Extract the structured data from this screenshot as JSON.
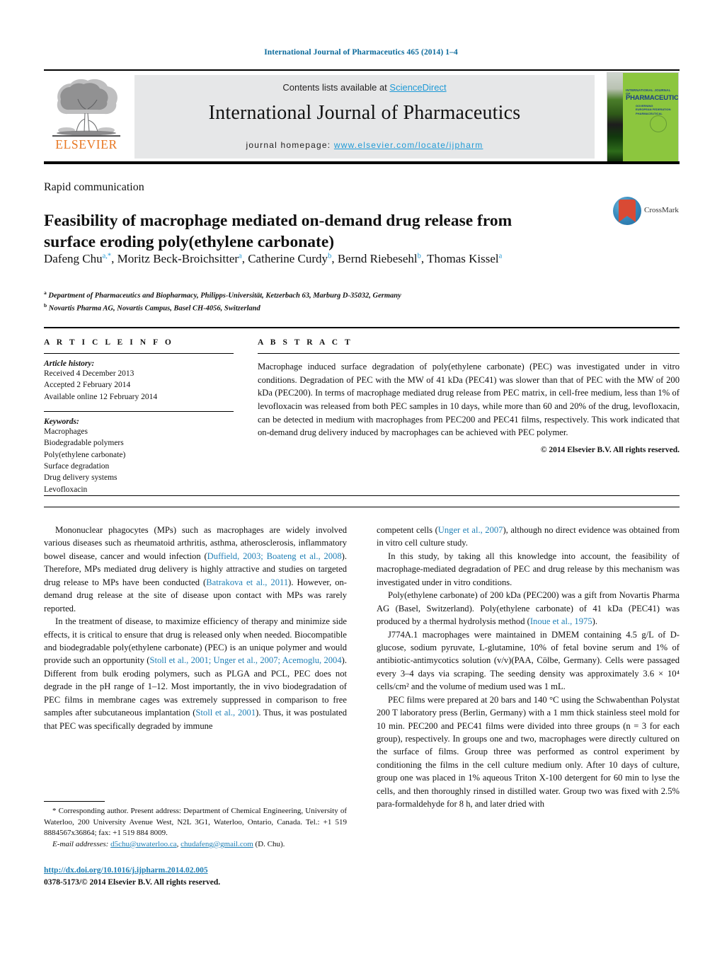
{
  "running_head": "International Journal of Pharmaceutics 465 (2014) 1–4",
  "masthead": {
    "contents_prefix": "Contents lists available at ",
    "sciencedirect": "ScienceDirect",
    "journal_title": "International Journal of Pharmaceutics",
    "homepage_label": "journal homepage: ",
    "homepage_url": "www.elsevier.com/locate/ijpharm",
    "publisher_logo_text": "ELSEVIER",
    "publisher_logo_color": "#e87722",
    "cover": {
      "line1": "INTERNATIONAL JOURNAL OF",
      "line2": "PHARMACEUTICS",
      "line3": "GOVERNING\\nEUROPEAN FEDERATION\\nPHARMACEUTICAL",
      "background_color": "#8cc63e"
    }
  },
  "article": {
    "type": "Rapid communication",
    "title": "Feasibility of macrophage mediated on-demand drug release from surface eroding poly(ethylene carbonate)",
    "authors_html": "Dafeng Chu<sup>a,*</sup>, Moritz Beck-Broichsitter<sup>a</sup>, Catherine Curdy<sup>b</sup>, Bernd Riebesehl<sup>b</sup>, Thomas Kissel<sup>a</sup>",
    "affiliation_a": "Department of Pharmaceutics and Biopharmacy, Philipps-Universität, Ketzerbach 63, Marburg D-35032, Germany",
    "affiliation_b": "Novartis Pharma AG, Novartis Campus, Basel CH-4056, Switzerland",
    "crossmark_label": "CrossMark"
  },
  "article_info": {
    "heading": "A R T I C L E   I N F O",
    "history_label": "Article history:",
    "history": [
      "Received 4 December 2013",
      "Accepted 2 February 2014",
      "Available online 12 February 2014"
    ],
    "keywords_label": "Keywords:",
    "keywords": [
      "Macrophages",
      "Biodegradable polymers",
      "Poly(ethylene carbonate)",
      "Surface degradation",
      "Drug delivery systems",
      "Levofloxacin"
    ]
  },
  "abstract": {
    "heading": "A B S T R A C T",
    "text": "Macrophage induced surface degradation of poly(ethylene carbonate) (PEC) was investigated under in vitro conditions. Degradation of PEC with the MW of 41 kDa (PEC41) was slower than that of PEC with the MW of 200 kDa (PEC200). In terms of macrophage mediated drug release from PEC matrix, in cell-free medium, less than 1% of levofloxacin was released from both PEC samples in 10 days, while more than 60 and 20% of the drug, levofloxacin, can be detected in medium with macrophages from PEC200 and PEC41 films, respectively. This work indicated that on-demand drug delivery induced by macrophages can be achieved with PEC polymer.",
    "copyright": "© 2014 Elsevier B.V. All rights reserved."
  },
  "body": {
    "left": [
      {
        "indent": true,
        "segments": [
          {
            "t": "Mononuclear phagocytes (MPs) such as macrophages are widely involved various diseases such as rheumatoid arthritis, asthma, atherosclerosis, inflammatory bowel disease, cancer and would infection ("
          },
          {
            "t": "Duffield, 2003; Boateng et al., 2008",
            "ref": true
          },
          {
            "t": "). Therefore, MPs mediated drug delivery is highly attractive and studies on targeted drug release to MPs have been conducted ("
          },
          {
            "t": "Batrakova et al., 2011",
            "ref": true
          },
          {
            "t": "). However, on-demand drug release at the site of disease upon contact with MPs was rarely reported."
          }
        ]
      },
      {
        "indent": true,
        "segments": [
          {
            "t": "In the treatment of disease, to maximize efficiency of therapy and minimize side effects, it is critical to ensure that drug is released only when needed. Biocompatible and biodegradable poly(ethylene carbonate) (PEC) is an unique polymer and would provide such an opportunity ("
          },
          {
            "t": "Stoll et al., 2001; Unger et al., 2007; Acemoglu, 2004",
            "ref": true
          },
          {
            "t": "). Different from bulk eroding polymers, such as PLGA and PCL, PEC does not degrade in the pH range of 1–12. Most importantly, the in vivo biodegradation of PEC films in membrane cages was extremely suppressed in comparison to free samples after subcutaneous implantation ("
          },
          {
            "t": "Stoll et al., 2001",
            "ref": true
          },
          {
            "t": "). Thus, it was postulated that PEC was specifically degraded by immune"
          }
        ]
      }
    ],
    "right": [
      {
        "indent": false,
        "segments": [
          {
            "t": "competent cells ("
          },
          {
            "t": "Unger et al., 2007",
            "ref": true
          },
          {
            "t": "), although no direct evidence was obtained from in vitro cell culture study."
          }
        ]
      },
      {
        "indent": true,
        "segments": [
          {
            "t": "In this study, by taking all this knowledge into account, the feasibility of macrophage-mediated degradation of PEC and drug release by this mechanism was investigated under in vitro conditions."
          }
        ]
      },
      {
        "indent": true,
        "segments": [
          {
            "t": "Poly(ethylene carbonate) of 200 kDa (PEC200) was a gift from Novartis Pharma AG (Basel, Switzerland). Poly(ethylene carbonate) of 41 kDa (PEC41) was produced by a thermal hydrolysis method ("
          },
          {
            "t": "Inoue et al., 1975",
            "ref": true
          },
          {
            "t": ")."
          }
        ]
      },
      {
        "indent": true,
        "segments": [
          {
            "t": "J774A.1 macrophages were maintained in DMEM containing 4.5 g/L of D-glucose, sodium pyruvate, L-glutamine, 10% of fetal bovine serum and 1% of antibiotic-antimycotics solution (v/v)(PAA, Cölbe, Germany). Cells were passaged every 3–4 days via scraping. The seeding density was approximately 3.6 × 10⁴ cells/cm² and the volume of medium used was 1 mL."
          }
        ]
      },
      {
        "indent": true,
        "segments": [
          {
            "t": "PEC films were prepared at 20 bars and 140 °C using the Schwabenthan Polystat 200 T laboratory press (Berlin, Germany) with a 1 mm thick stainless steel mold for 10 min. PEC200 and PEC41 films were divided into three groups (n = 3 for each group), respectively. In groups one and two, macrophages were directly cultured on the surface of films. Group three was performed as control experiment by conditioning the films in the cell culture medium only. After 10 days of culture, group one was placed in 1% aqueous Triton X-100 detergent for 60 min to lyse the cells, and then thoroughly rinsed in distilled water. Group two was fixed with 2.5% para-formaldehyde for 8 h, and later dried with"
          }
        ]
      }
    ]
  },
  "footnotes": {
    "corresponding": "* Corresponding author. Present address: Department of Chemical Engineering, University of Waterloo, 200 University Avenue West, N2L 3G1, Waterloo, Ontario, Canada. Tel.: +1 519 8884567x36864; fax: +1 519 884 8009.",
    "email_label": "E-mail addresses:",
    "email_1": "d5chu@uwaterloo.ca",
    "email_2": "chudafeng@gmail.com",
    "email_suffix": "(D. Chu)."
  },
  "publication": {
    "doi": "http://dx.doi.org/10.1016/j.ijpharm.2014.02.005",
    "issn_line": "0378-5173/© 2014 Elsevier B.V. All rights reserved."
  }
}
